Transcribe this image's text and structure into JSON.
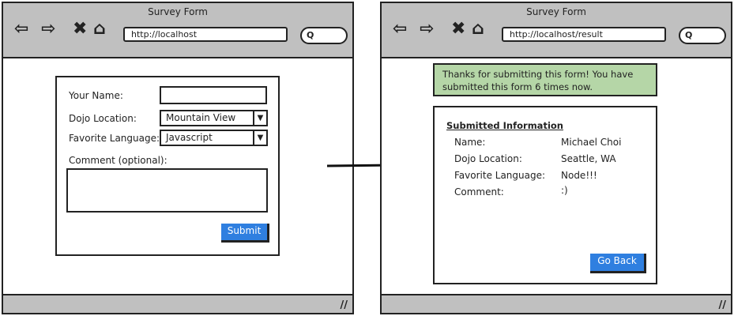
{
  "left": {
    "title": "Survey Form",
    "url": "http://localhost",
    "form": {
      "name_label": "Your Name:",
      "name_value": "",
      "location_label": "Dojo Location:",
      "location_value": "Mountain View",
      "language_label": "Favorite Language:",
      "language_value": "Javascript",
      "comment_label": "Comment (optional):",
      "comment_value": "",
      "submit": "Submit"
    }
  },
  "right": {
    "title": "Survey Form",
    "url": "http://localhost/result",
    "message": "Thanks for submitting this form!  You have submitted this form 6 times now.",
    "heading": "Submitted Information",
    "rows": [
      {
        "label": "Name:",
        "value": "Michael Choi"
      },
      {
        "label": "Dojo Location:",
        "value": "Seattle, WA"
      },
      {
        "label": "Favorite Language:",
        "value": "Node!!!"
      },
      {
        "label": "Comment:",
        "value": ":)"
      }
    ],
    "go_back": "Go Back"
  },
  "colors": {
    "chrome": "#c0c0c0",
    "button": "#2f7fe0",
    "success": "#b5d6a7"
  },
  "icons": {
    "back": "back-arrow-icon",
    "forward": "forward-arrow-icon",
    "stop": "close-icon",
    "home": "home-icon",
    "search": "search-icon",
    "arrow": "flow-arrow-icon"
  }
}
